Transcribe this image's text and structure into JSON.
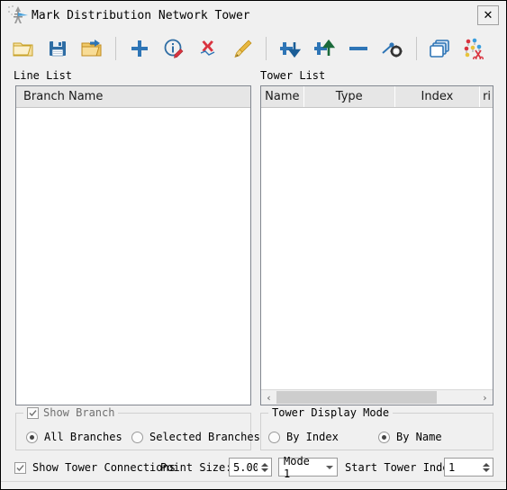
{
  "window": {
    "title": "Mark Distribution Network Tower",
    "icon": "transmission-tower-icon",
    "close_label": "✕"
  },
  "toolbar": {
    "items": [
      {
        "name": "open-file-icon",
        "tip": "Open"
      },
      {
        "name": "save-icon",
        "tip": "Save"
      },
      {
        "name": "open-folder-icon",
        "tip": "Open Folder"
      },
      {
        "name": "add-icon",
        "tip": "Add"
      },
      {
        "name": "info-edit-icon",
        "tip": "Edit Info"
      },
      {
        "name": "delete-icon",
        "tip": "Delete"
      },
      {
        "name": "brush-icon",
        "tip": "Brush"
      },
      {
        "name": "insert-below-icon",
        "tip": "Insert Below"
      },
      {
        "name": "insert-above-icon",
        "tip": "Insert Above"
      },
      {
        "name": "remove-line-icon",
        "tip": "Remove"
      },
      {
        "name": "connection-settings-icon",
        "tip": "Connection Settings"
      },
      {
        "name": "copy-layers-icon",
        "tip": "Copy"
      },
      {
        "name": "pins-scissors-icon",
        "tip": "Split Points"
      }
    ]
  },
  "line_list": {
    "label": "Line List",
    "columns": [
      "Branch Name"
    ],
    "rows": []
  },
  "tower_list": {
    "label": "Tower List",
    "columns": [
      "Name",
      "Type",
      "Index",
      "ri"
    ],
    "rows": [],
    "hscroll": {
      "left_arrow": "‹",
      "right_arrow": "›"
    }
  },
  "show_branch": {
    "title": "Show Branch",
    "checked": true,
    "options": [
      {
        "label": "All Branches",
        "selected": true
      },
      {
        "label": "Selected Branches",
        "selected": false
      }
    ]
  },
  "tower_display_mode": {
    "title": "Tower Display Mode",
    "options": [
      {
        "label": "By Index",
        "selected": false
      },
      {
        "label": "By Name",
        "selected": true
      }
    ]
  },
  "bottom_bar": {
    "show_tower_connections": {
      "label": "Show Tower Connections",
      "checked": true
    },
    "point_size": {
      "label": "Point Size:",
      "value": "5.00"
    },
    "mode": {
      "value": "Mode 1"
    },
    "start_tower_index": {
      "label": "Start Tower Index:",
      "value": "1"
    }
  },
  "colors": {
    "window_bg": "#f0f0f0",
    "panel_bg": "#ffffff",
    "header_bg": "#e6e6e6",
    "border": "#828790",
    "accent_blue": "#2e75b6",
    "accent_red": "#d9333f"
  }
}
